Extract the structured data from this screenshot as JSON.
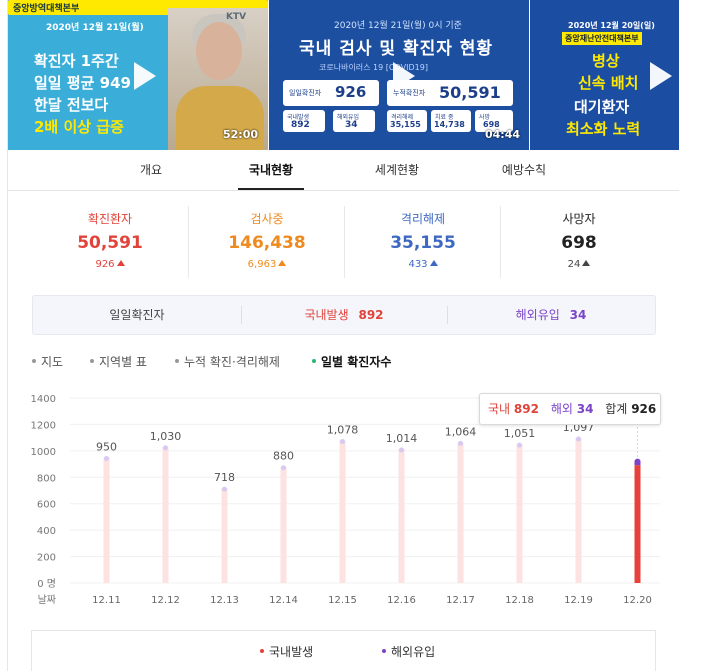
{
  "videos": [
    {
      "date": "2020년 12월 21일(월)",
      "org": "중앙방역대책본부",
      "lines": [
        "확진자 1주간",
        "일일 평균 949",
        "한달 전보다",
        "2배 이상 급증"
      ],
      "logo": "KTV",
      "duration": "52:00"
    },
    {
      "date": "2020년 12월 21일(월) 0시 기준",
      "title": "국내 검사 및 확진자 현황",
      "sub": "코로나바이러스 19 [COVID19]",
      "daily_label": "일일확진자",
      "daily_value": "926",
      "total_label": "누적확진자",
      "total_value": "50,591",
      "domestic_label": "국내발생",
      "domestic_value": "892",
      "overseas_label": "해외유입",
      "overseas_value": "34",
      "released_label": "격리해제",
      "released_value": "35,155",
      "treating_label": "치료 중",
      "treating_value": "14,738",
      "deaths_label": "사망",
      "deaths_value": "698",
      "duration": "04:44"
    },
    {
      "date": "2020년 12월 20일(일)",
      "org": "중앙재난안전대책본부",
      "lines": [
        "병상",
        "신속 배치",
        "대기환자",
        "최소화 노력"
      ]
    }
  ],
  "tabs": [
    "개요",
    "국내현황",
    "세계현황",
    "예방수칙"
  ],
  "active_tab": "국내현황",
  "stats": [
    {
      "label": "확진환자",
      "value": "50,591",
      "delta": "926",
      "color": "#e0433a"
    },
    {
      "label": "검사중",
      "value": "146,438",
      "delta": "6,963",
      "color": "#ee8a1e"
    },
    {
      "label": "격리해제",
      "value": "35,155",
      "delta": "433",
      "color": "#3d68c4"
    },
    {
      "label": "사망자",
      "value": "698",
      "delta": "24",
      "color": "#222222"
    }
  ],
  "daily": {
    "label": "일일확진자",
    "domestic_label": "국내발생",
    "domestic_value": "892",
    "overseas_label": "해외유입",
    "overseas_value": "34"
  },
  "filters": [
    "지도",
    "지역별 표",
    "누적 확진·격리해제",
    "일별 확진자수"
  ],
  "active_filter": "일별 확진자수",
  "tooltip": {
    "domestic_label": "국내",
    "domestic_value": "892",
    "overseas_label": "해외",
    "overseas_value": "34",
    "total_label": "합계",
    "total_value": "926"
  },
  "legend": {
    "domestic": "국내발생",
    "overseas": "해외유입"
  },
  "colors": {
    "domestic": "#e8403a",
    "overseas": "#7b44c8",
    "bar_faint": "#fde2e2"
  },
  "chart_data": {
    "type": "bar",
    "categories": [
      "12.11",
      "12.12",
      "12.13",
      "12.14",
      "12.15",
      "12.16",
      "12.17",
      "12.18",
      "12.19",
      "12.20"
    ],
    "values": [
      950,
      1030,
      718,
      880,
      1078,
      1014,
      1064,
      1051,
      1097,
      926
    ],
    "value_labels": [
      "950",
      "1,030",
      "718",
      "880",
      "1,078",
      "1,014",
      "1,064",
      "1,051",
      "1,097",
      ""
    ],
    "series": [
      {
        "name": "국내발생",
        "values": [
          null,
          null,
          null,
          null,
          null,
          null,
          null,
          null,
          null,
          892
        ]
      },
      {
        "name": "해외유입",
        "values": [
          null,
          null,
          null,
          null,
          null,
          null,
          null,
          null,
          null,
          34
        ]
      }
    ],
    "yticks": [
      "1400",
      "1200",
      "1000",
      "800",
      "600",
      "400",
      "200",
      "0 명"
    ],
    "xlabel": "날짜",
    "ylim": [
      0,
      1400
    ],
    "highlighted": "12.20"
  }
}
